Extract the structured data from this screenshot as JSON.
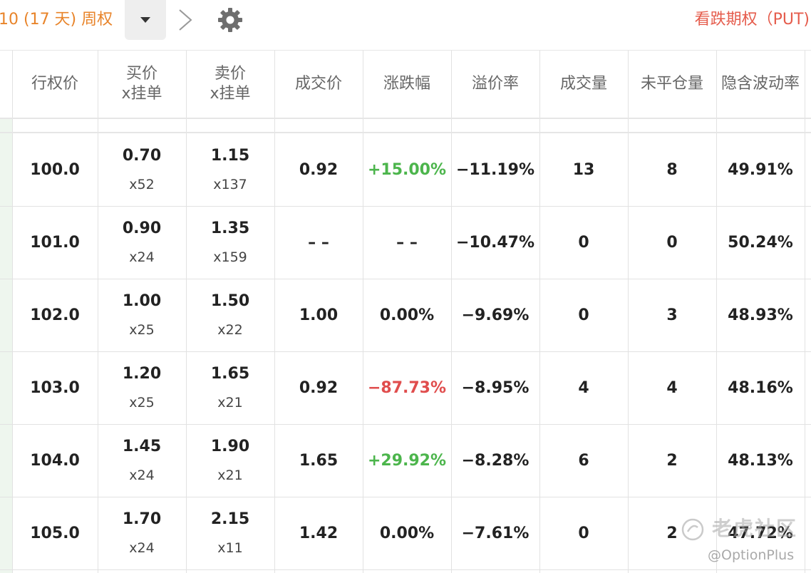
{
  "toolbar": {
    "expiry_label": "10 (17 天) 周权",
    "put_label": "看跌期权（PUT)"
  },
  "columns": [
    {
      "key": "strike",
      "lines": [
        "行权价"
      ]
    },
    {
      "key": "bid",
      "lines": [
        "买价",
        "x挂单"
      ]
    },
    {
      "key": "ask",
      "lines": [
        "卖价",
        "x挂单"
      ]
    },
    {
      "key": "last",
      "lines": [
        "成交价"
      ]
    },
    {
      "key": "change",
      "lines": [
        "涨跌幅"
      ]
    },
    {
      "key": "premium",
      "lines": [
        "溢价率"
      ]
    },
    {
      "key": "volume",
      "lines": [
        "成交量"
      ]
    },
    {
      "key": "oi",
      "lines": [
        "未平仓量"
      ]
    },
    {
      "key": "iv",
      "lines": [
        "隐含波动率"
      ]
    }
  ],
  "rows": [
    {
      "strike": "100.0",
      "bid": "0.70",
      "bid_size": "x52",
      "ask": "1.15",
      "ask_size": "x137",
      "last": "0.92",
      "change": "+15.00%",
      "change_dir": "up",
      "premium": "−11.19%",
      "volume": "13",
      "oi": "8",
      "iv": "49.91%"
    },
    {
      "strike": "101.0",
      "bid": "0.90",
      "bid_size": "x24",
      "ask": "1.35",
      "ask_size": "x159",
      "last": "– –",
      "change": "– –",
      "change_dir": "none",
      "premium": "−10.47%",
      "volume": "0",
      "oi": "0",
      "iv": "50.24%"
    },
    {
      "strike": "102.0",
      "bid": "1.00",
      "bid_size": "x25",
      "ask": "1.50",
      "ask_size": "x22",
      "last": "1.00",
      "change": "0.00%",
      "change_dir": "none",
      "premium": "−9.69%",
      "volume": "0",
      "oi": "3",
      "iv": "48.93%"
    },
    {
      "strike": "103.0",
      "bid": "1.20",
      "bid_size": "x25",
      "ask": "1.65",
      "ask_size": "x21",
      "last": "0.92",
      "change": "−87.73%",
      "change_dir": "down",
      "premium": "−8.95%",
      "volume": "4",
      "oi": "4",
      "iv": "48.16%"
    },
    {
      "strike": "104.0",
      "bid": "1.45",
      "bid_size": "x24",
      "ask": "1.90",
      "ask_size": "x21",
      "last": "1.65",
      "change": "+29.92%",
      "change_dir": "up",
      "premium": "−8.28%",
      "volume": "6",
      "oi": "2",
      "iv": "48.13%"
    },
    {
      "strike": "105.0",
      "bid": "1.70",
      "bid_size": "x24",
      "ask": "2.15",
      "ask_size": "x11",
      "last": "1.42",
      "change": "0.00%",
      "change_dir": "none",
      "premium": "−7.61%",
      "volume": "0",
      "oi": "2",
      "iv": "47.72%"
    }
  ],
  "colors": {
    "up": "#4cb54c",
    "down": "#e04d4d",
    "accent_orange": "#e8842a",
    "put_red": "#e55c4c"
  },
  "watermark": {
    "text": "老虎社区",
    "handle": "@OptionPlus"
  },
  "icons": {
    "dropdown": "caret-down-icon",
    "next": "chevron-right-icon",
    "settings": "gear-icon"
  }
}
